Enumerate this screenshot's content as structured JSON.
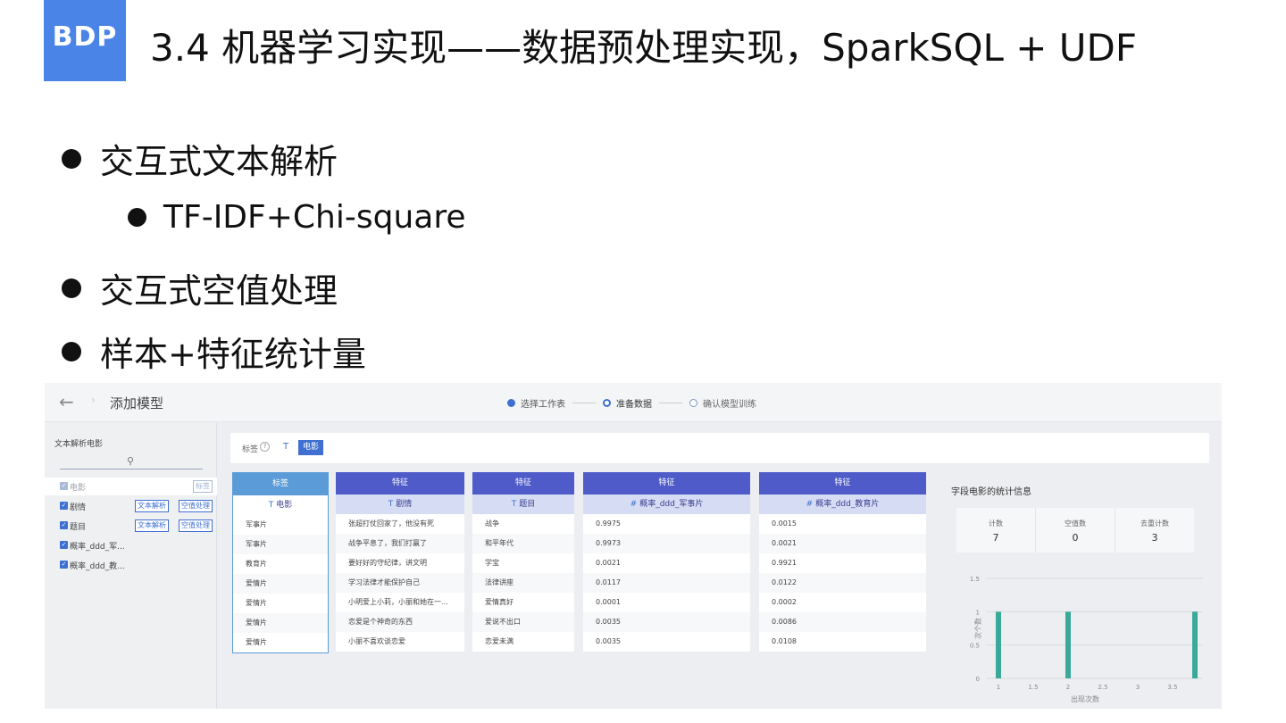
{
  "slide": {
    "logo": "BDP",
    "title": "3.4 机器学习实现——数据预处理实现，SparkSQL + UDF",
    "bullets": [
      "交互式文本解析",
      "TF-IDF+Chi-square",
      "交互式空值处理",
      "样本+特征统计量"
    ]
  },
  "app": {
    "back_icon": "←",
    "back_sep": "›",
    "title": "添加模型",
    "steps": [
      "选择工作表",
      "准备数据",
      "确认模型训练"
    ],
    "sidebar": {
      "title": "文本解析电影",
      "search_icon": "magnifier-icon",
      "items": [
        {
          "label": "电影",
          "tag": "标签"
        },
        {
          "label": "剧情",
          "btn1": "文本解析",
          "btn2": "空值处理"
        },
        {
          "label": "题目",
          "btn1": "文本解析",
          "btn2": "空值处理"
        },
        {
          "label": "概率_ddd_军..."
        },
        {
          "label": "概率_ddd_教..."
        }
      ]
    },
    "tagbar": {
      "label": "标签",
      "help": "?",
      "type": "T",
      "chip": "电影"
    },
    "columns": [
      {
        "role": "标签",
        "type": "T",
        "name": "电影",
        "cells": [
          "军事片",
          "军事片",
          "教育片",
          "爱情片",
          "爱情片",
          "爱情片",
          "爱情片"
        ]
      },
      {
        "role": "特征",
        "type": "T",
        "name": "剧情",
        "cells": [
          "张超打仗回家了，他没有死",
          "战争平息了，我们打赢了",
          "要好好的守纪律，讲文明",
          "学习法律才能保护自己",
          "小明爱上小莉，小丽和她在一...",
          "恋爱是个神奇的东西",
          "小丽不喜欢谈恋爱"
        ]
      },
      {
        "role": "特征",
        "type": "T",
        "name": "题目",
        "cells": [
          "战争",
          "和平年代",
          "学宝",
          "法律讲座",
          "爱情真好",
          "爱说不出口",
          "恋爱未满"
        ]
      },
      {
        "role": "特征",
        "type": "#",
        "name": "概率_ddd_军事片",
        "cells": [
          "0.9975",
          "0.9973",
          "0.0021",
          "0.0117",
          "0.0001",
          "0.0035",
          "0.0035"
        ]
      },
      {
        "role": "特征",
        "type": "#",
        "name": "概率_ddd_教育片",
        "cells": [
          "0.0015",
          "0.0021",
          "0.9921",
          "0.0122",
          "0.0002",
          "0.0086",
          "0.0108"
        ]
      }
    ],
    "stats": {
      "title": "字段电影的统计信息",
      "items": [
        {
          "k": "计数",
          "v": "7"
        },
        {
          "k": "空值数",
          "v": "0"
        },
        {
          "k": "去重计数",
          "v": "3"
        }
      ]
    }
  },
  "chart_data": {
    "type": "bar",
    "xlabel": "出现次数",
    "ylabel": "次个数",
    "x": [
      1,
      2,
      4
    ],
    "values": [
      1,
      1,
      1
    ],
    "xlim": [
      0.9,
      4.1
    ],
    "ylim": [
      0,
      1.5
    ],
    "xticks": [
      "1",
      "1.5",
      "2",
      "2.5",
      "3",
      "3.5"
    ],
    "yticks": [
      "0",
      "0.5",
      "1",
      "1.5"
    ],
    "color": "#3aa99a"
  }
}
